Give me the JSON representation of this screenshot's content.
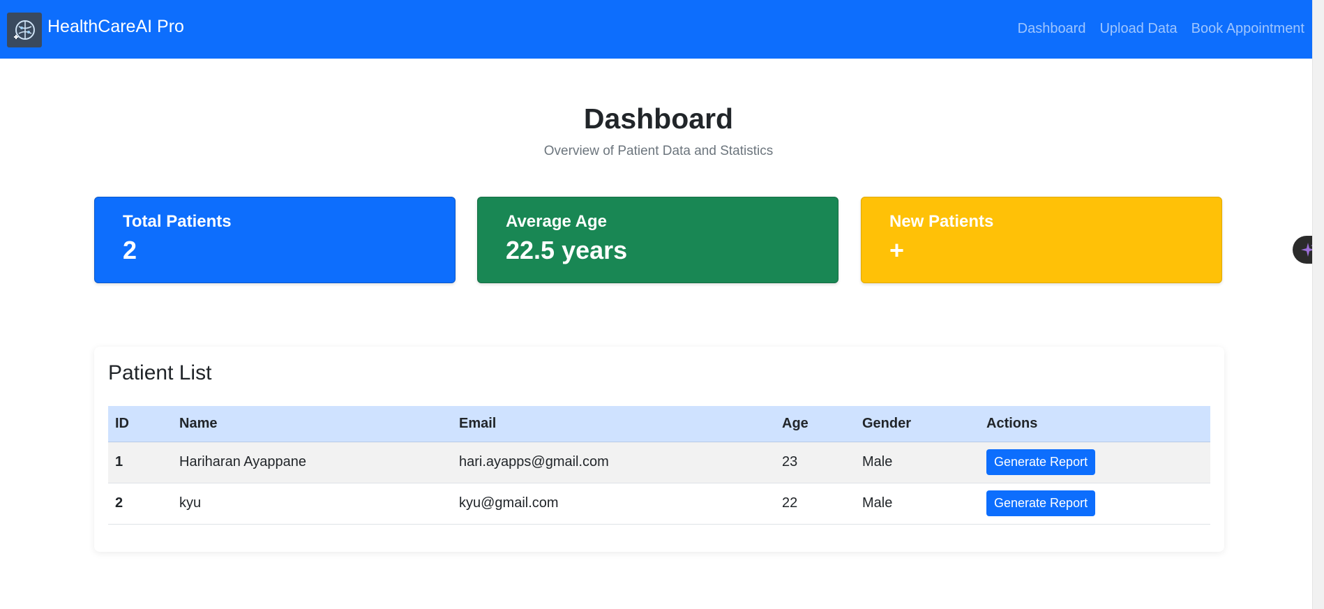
{
  "navbar": {
    "brand": "HealthCareAI Pro",
    "logo_icon": "brain-circuit-icon",
    "links": [
      "Dashboard",
      "Upload Data",
      "Book Appointment"
    ]
  },
  "page": {
    "title": "Dashboard",
    "subtitle": "Overview of Patient Data and Statistics"
  },
  "stats": [
    {
      "label": "Total Patients",
      "value": "2",
      "color": "#0d6efd"
    },
    {
      "label": "Average Age",
      "value": "22.5 years",
      "color": "#198754"
    },
    {
      "label": "New Patients",
      "value": "+",
      "color": "#ffc107"
    }
  ],
  "patient_list": {
    "title": "Patient List",
    "columns": [
      "ID",
      "Name",
      "Email",
      "Age",
      "Gender",
      "Actions"
    ],
    "rows": [
      {
        "id": "1",
        "name": "Hariharan Ayappane",
        "email": "hari.ayapps@gmail.com",
        "age": "23",
        "gender": "Male",
        "action": "Generate Report"
      },
      {
        "id": "2",
        "name": "kyu",
        "email": "kyu@gmail.com",
        "age": "22",
        "gender": "Male",
        "action": "Generate Report"
      }
    ]
  },
  "assistant": {
    "icon": "sparkle-icon",
    "color": "#9b6fd8"
  }
}
